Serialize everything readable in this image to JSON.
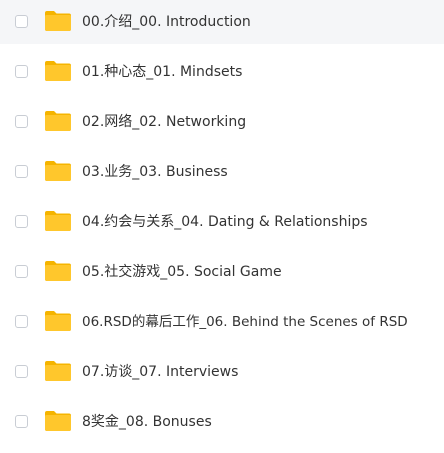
{
  "colors": {
    "folder_body": "#FFC72C",
    "folder_tab": "#F5B400",
    "text": "#333333",
    "checkbox_border": "#C9CDD4",
    "row_hover": "#F5F6F8"
  },
  "files": [
    {
      "name": "00.介绍_00. Introduction",
      "icon": "folder-icon"
    },
    {
      "name": "01.种心态_01. Mindsets",
      "icon": "folder-icon"
    },
    {
      "name": "02.网络_02. Networking",
      "icon": "folder-icon"
    },
    {
      "name": "03.业务_03. Business",
      "icon": "folder-icon"
    },
    {
      "name": "04.约会与关系_04. Dating & Relationships",
      "icon": "folder-icon"
    },
    {
      "name": "05.社交游戏_05. Social Game",
      "icon": "folder-icon"
    },
    {
      "name": "06.RSD的幕后工作_06. Behind the Scenes of RSD",
      "icon": "folder-icon"
    },
    {
      "name": "07.访谈_07. Interviews",
      "icon": "folder-icon"
    },
    {
      "name": "8奖金_08. Bonuses",
      "icon": "folder-icon"
    }
  ]
}
